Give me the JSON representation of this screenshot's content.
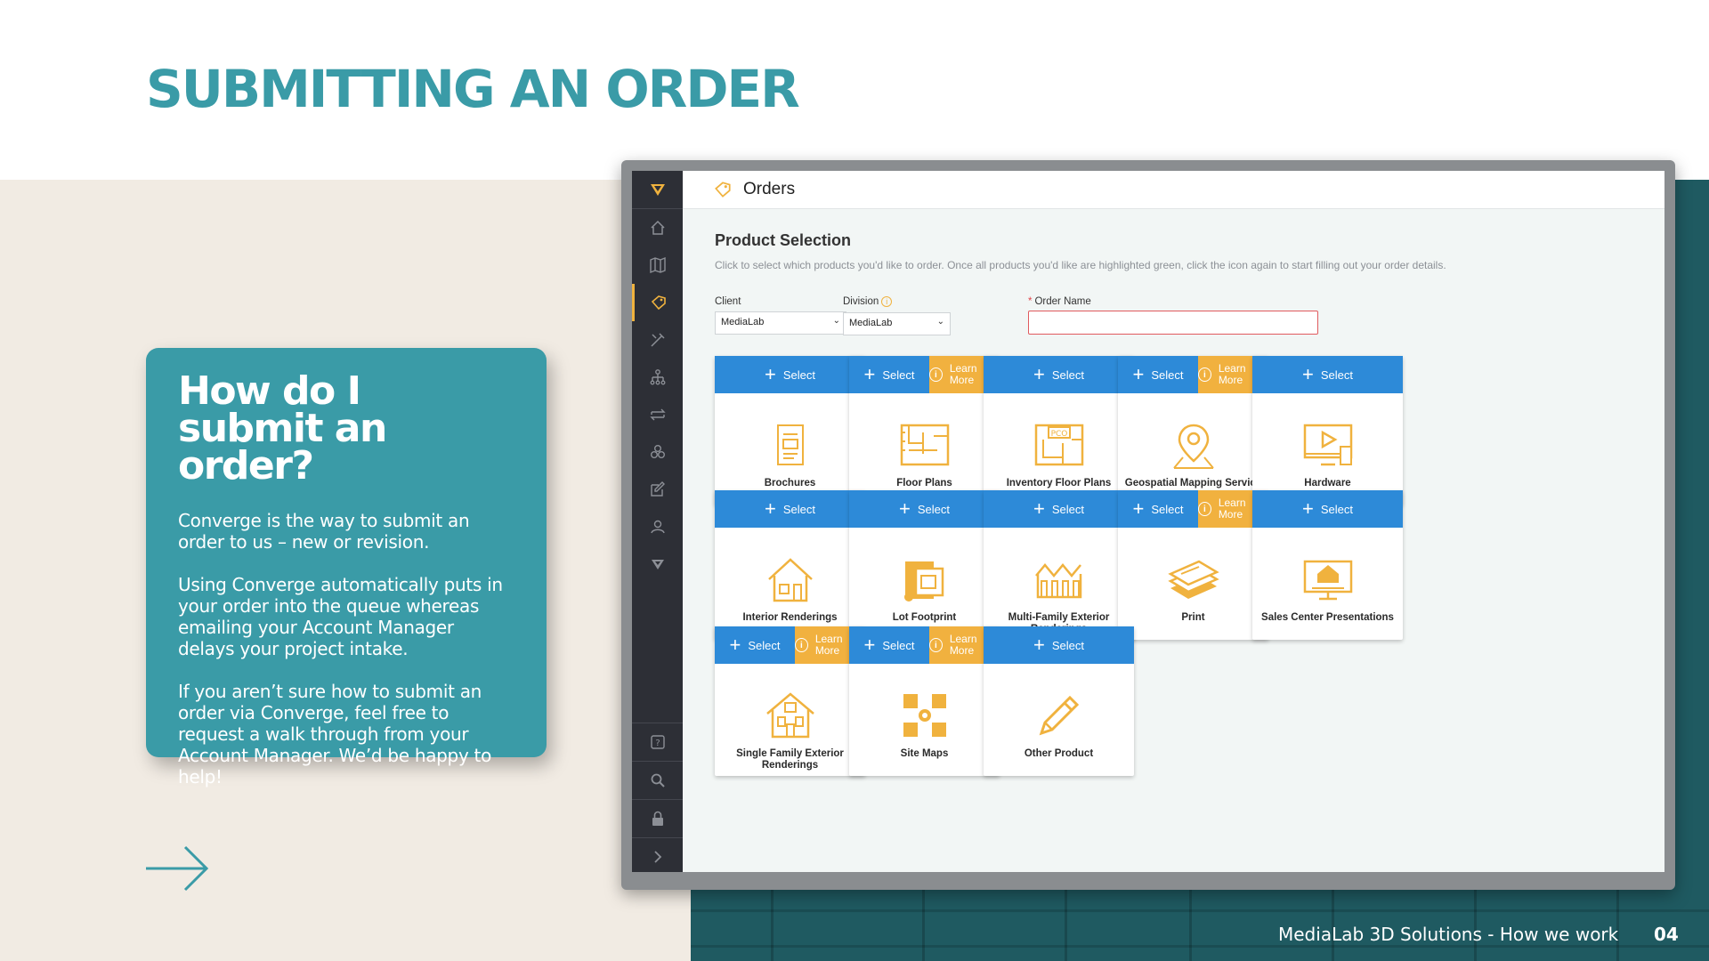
{
  "slide": {
    "title": "SUBMITTING AN ORDER",
    "footer": "MediaLab 3D Solutions - How we work",
    "page_number": "04"
  },
  "info_card": {
    "heading": "How do I submit an order?",
    "paragraphs": [
      "Converge is the way to submit an order to us – new or revision.",
      "Using Converge automatically puts in your order into the queue whereas emailing your Account Manager delays your project intake.",
      "If you aren’t sure how to submit an order via Converge, feel free to request a walk through from your Account Manager. We’d be happy to help!"
    ]
  },
  "app": {
    "page_title": "Orders",
    "section_title": "Product Selection",
    "section_description": "Click to select which products you'd like to order. Once all products you'd like are highlighted green, click the icon again to start filling out your order details.",
    "form": {
      "client_label": "Client",
      "client_value": "MediaLab",
      "division_label": "Division",
      "division_value": "MediaLab",
      "order_name_label": "Order Name",
      "order_name_required": "*",
      "order_name_value": ""
    },
    "select_label": "Select",
    "learn_more_label": "Learn More",
    "products": [
      {
        "name": "Brochures",
        "icon": "brochure-icon",
        "learn_more": false
      },
      {
        "name": "Floor Plans",
        "icon": "floor-plan-icon",
        "learn_more": true
      },
      {
        "name": "Inventory Floor Plans",
        "icon": "inventory-floor-plan-icon",
        "learn_more": false
      },
      {
        "name": "Geospatial Mapping Service",
        "icon": "map-pin-icon",
        "learn_more": true
      },
      {
        "name": "Hardware",
        "icon": "hardware-icon",
        "learn_more": false
      },
      {
        "name": "Interior Renderings",
        "icon": "interior-house-icon",
        "learn_more": false
      },
      {
        "name": "Lot Footprint",
        "icon": "lot-footprint-icon",
        "learn_more": false
      },
      {
        "name": "Multi-Family Exterior Renderings",
        "icon": "multi-family-icon",
        "learn_more": false
      },
      {
        "name": "Print",
        "icon": "print-stack-icon",
        "learn_more": true
      },
      {
        "name": "Sales Center Presentations",
        "icon": "presentation-screen-icon",
        "learn_more": false
      },
      {
        "name": "Single Family Exterior Renderings",
        "icon": "single-family-icon",
        "learn_more": true
      },
      {
        "name": "Site Maps",
        "icon": "site-map-icon",
        "learn_more": true
      },
      {
        "name": "Other Product",
        "icon": "pencil-icon",
        "learn_more": false
      }
    ],
    "sidebar_icons": [
      "logo-icon",
      "home-icon",
      "map-icon",
      "orders-icon",
      "tools-icon",
      "hierarchy-icon",
      "transfer-icon",
      "assets-icon",
      "edit-icon",
      "users-icon",
      "brand-icon"
    ],
    "sidebar_bottom_icons": [
      "help-icon",
      "search-icon",
      "lock-icon",
      "expand-icon"
    ]
  },
  "colors": {
    "teal": "#3a9ba7",
    "select_blue": "#2d8ad8",
    "learn_orange": "#f1b13f",
    "icon_orange": "#f0b23e",
    "sidebar": "#2d2f36"
  }
}
